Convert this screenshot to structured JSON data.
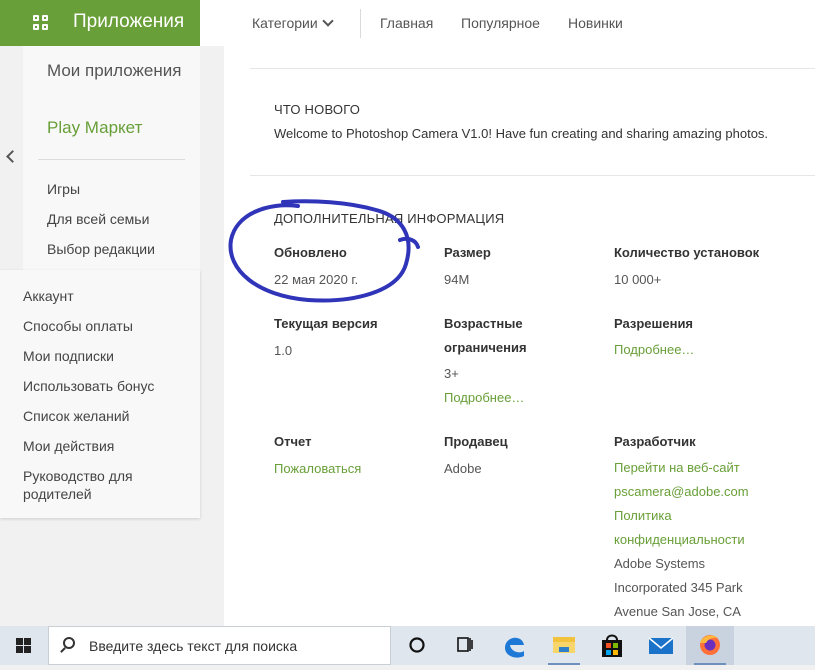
{
  "brand": {
    "title": "Приложения"
  },
  "topnav": {
    "categories": "Категории",
    "home": "Главная",
    "popular": "Популярное",
    "new": "Новинки"
  },
  "sidebar": {
    "my_apps": "Мои приложения",
    "play_market": "Play Маркет",
    "items": [
      "Игры",
      "Для всей семьи",
      "Выбор редакции"
    ]
  },
  "account_menu": [
    "Аккаунт",
    "Способы оплаты",
    "Мои подписки",
    "Использовать бонус",
    "Список желаний",
    "Мои действия",
    "Руководство для родителей"
  ],
  "whats_new": {
    "heading": "ЧТО НОВОГО",
    "text": "Welcome to Photoshop Camera V1.0! Have fun creating and sharing amazing photos."
  },
  "additional_info": {
    "heading": "ДОПОЛНИТЕЛЬНАЯ ИНФОРМАЦИЯ",
    "updated_label": "Обновлено",
    "updated_value": "22 мая 2020 г.",
    "size_label": "Размер",
    "size_value": "94M",
    "installs_label": "Количество установок",
    "installs_value": "10 000+",
    "version_label": "Текущая версия",
    "version_value": "1.0",
    "age_label_1": "Возрастные",
    "age_label_2": "ограничения",
    "age_value": "3+",
    "age_more": "Подробнее…",
    "permissions_label": "Разрешения",
    "permissions_more": "Подробнее…",
    "report_label": "Отчет",
    "report_link": "Пожаловаться",
    "seller_label": "Продавец",
    "seller_value": "Adobe",
    "developer_label": "Разработчик",
    "developer_website": "Перейти на веб-сайт",
    "developer_email": "pscamera@adobe.com",
    "privacy_1": "Политика",
    "privacy_2": "конфиденциальности",
    "address_1": "Adobe Systems",
    "address_2": "Incorporated 345 Park",
    "address_3": "Avenue San Jose, CA"
  },
  "taskbar": {
    "search_placeholder": "Введите здесь текст для поиска"
  },
  "colors": {
    "accent_green": "#689f38",
    "annotation_blue": "#2f34b8"
  }
}
